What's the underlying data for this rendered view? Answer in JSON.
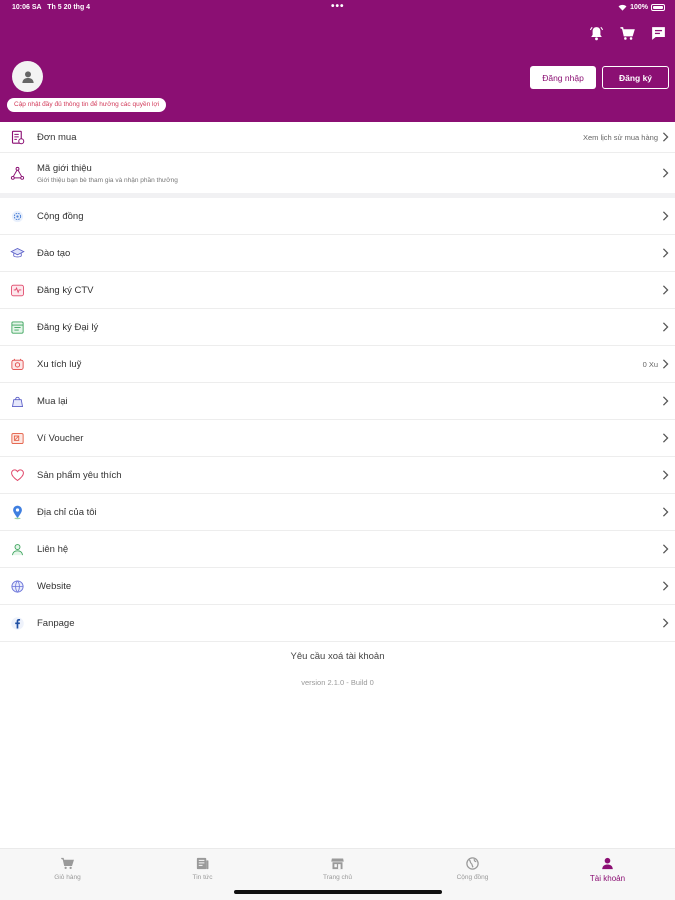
{
  "status_bar": {
    "time": "10:06 SA",
    "date": "Th 5 20 thg 4",
    "dots": "•••",
    "battery": "100%"
  },
  "header": {
    "update_note": "Cập nhật đầy đủ thông tin để hưởng các quyền lợi",
    "login_label": "Đăng nhập",
    "register_label": "Đăng ký",
    "background_color": "#8b0f73",
    "icons": [
      "bell-icon",
      "cart-icon",
      "message-icon"
    ]
  },
  "orders": {
    "label": "Đơn mua",
    "right_text": "Xem lịch sử mua hàng"
  },
  "referral": {
    "label": "Mã giới thiệu",
    "subtitle": "Giới thiệu bạn bè tham gia và nhận phần thưởng"
  },
  "menu": [
    {
      "label": "Cộng đồng",
      "icon": "community-icon",
      "value": ""
    },
    {
      "label": "Đào tạo",
      "icon": "graduation-cap-icon",
      "value": ""
    },
    {
      "label": "Đăng ký CTV",
      "icon": "heart-monitor-icon",
      "value": ""
    },
    {
      "label": "Đăng ký Đại lý",
      "icon": "store-icon",
      "value": ""
    },
    {
      "label": "Xu tích luỹ",
      "icon": "coin-box-icon",
      "value": "0 Xu"
    },
    {
      "label": "Mua lại",
      "icon": "bag-icon",
      "value": ""
    },
    {
      "label": "Ví Voucher",
      "icon": "voucher-icon",
      "value": ""
    },
    {
      "label": "Sản phẩm yêu thích",
      "icon": "heart-icon",
      "value": ""
    },
    {
      "label": "Địa chỉ của tôi",
      "icon": "location-pin-icon",
      "value": ""
    },
    {
      "label": "Liên hệ",
      "icon": "contact-icon",
      "value": ""
    },
    {
      "label": "Website",
      "icon": "globe-icon",
      "value": ""
    },
    {
      "label": "Fanpage",
      "icon": "facebook-icon",
      "value": ""
    }
  ],
  "footer": {
    "delete_account": "Yêu cầu xoá tài khoản",
    "version": "version 2.1.0 - Build 0"
  },
  "tabs": [
    {
      "label": "Giỏ hàng",
      "icon": "cart-icon",
      "active": false
    },
    {
      "label": "Tin tức",
      "icon": "news-icon",
      "active": false
    },
    {
      "label": "Trang chủ",
      "icon": "storefront-icon",
      "active": false
    },
    {
      "label": "Cộng đồng",
      "icon": "globe-icon",
      "active": false
    },
    {
      "label": "Tài khoản",
      "icon": "user-icon",
      "active": true
    }
  ]
}
